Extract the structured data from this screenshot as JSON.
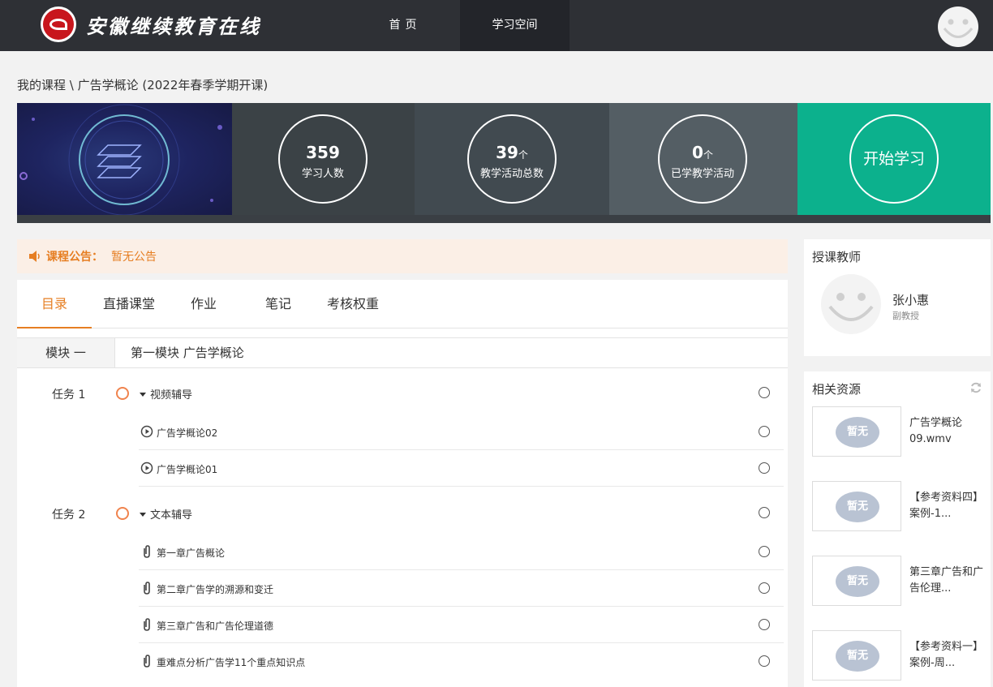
{
  "header": {
    "logo_text": "安徽继续教育在线",
    "nav": [
      {
        "label": "首页"
      },
      {
        "label": "学习空间"
      }
    ]
  },
  "breadcrumb": "我的课程 \\ 广告学概论 (2022年春季学期开课)",
  "stats": [
    {
      "value": "359",
      "unit": "",
      "label": "学习人数"
    },
    {
      "value": "39",
      "unit": "个",
      "label": "教学活动总数"
    },
    {
      "value": "0",
      "unit": "个",
      "label": "已学教学活动"
    }
  ],
  "start_button": "开始学习",
  "notice": {
    "label": "课程公告：",
    "text": "暂无公告"
  },
  "tabs": [
    {
      "label": "目录"
    },
    {
      "label": "直播课堂"
    },
    {
      "label": "作业"
    },
    {
      "label": "笔记"
    },
    {
      "label": "考核权重"
    }
  ],
  "module": {
    "label": "模块 一",
    "title": "第一模块 广告学概论"
  },
  "tasks": [
    {
      "label": "任务 1",
      "title": "视频辅导",
      "items": [
        {
          "title": "广告学概论02",
          "icon": "play-icon"
        },
        {
          "title": "广告学概论01",
          "icon": "play-icon"
        }
      ]
    },
    {
      "label": "任务 2",
      "title": "文本辅导",
      "items": [
        {
          "title": "第一章广告概论",
          "icon": "attachment-icon"
        },
        {
          "title": "第二章广告学的溯源和变迁",
          "icon": "attachment-icon"
        },
        {
          "title": "第三章广告和广告伦理道德",
          "icon": "attachment-icon"
        },
        {
          "title": "重难点分析广告学11个重点知识点",
          "icon": "attachment-icon"
        }
      ]
    }
  ],
  "teacher": {
    "title": "授课教师",
    "name": "张小惠",
    "role": "副教授"
  },
  "resources": {
    "title": "相关资源",
    "thumb_label": "暂无",
    "items": [
      {
        "name": "广告学概论09.wmv"
      },
      {
        "name": "【参考资料四】案例-1..."
      },
      {
        "name": "第三章广告和广告伦理..."
      },
      {
        "name": "【参考资料一】案例-周..."
      }
    ]
  },
  "colors": {
    "header_bg": "#2e3035",
    "accent_orange": "#e67e22",
    "start_green": "#0cb18d"
  }
}
